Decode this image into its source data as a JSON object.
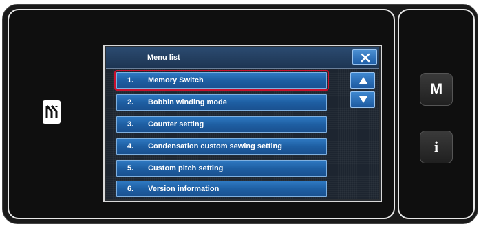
{
  "screen": {
    "title": "Menu list",
    "close_icon": "close-icon",
    "menu_items": [
      {
        "number": "1.",
        "label": "Memory Switch",
        "selected": true
      },
      {
        "number": "2.",
        "label": "Bobbin winding mode",
        "selected": false
      },
      {
        "number": "3.",
        "label": "Counter setting",
        "selected": false
      },
      {
        "number": "4.",
        "label": "Condensation custom sewing setting",
        "selected": false
      },
      {
        "number": "5.",
        "label": "Custom pitch setting",
        "selected": false
      },
      {
        "number": "6.",
        "label": "Version information",
        "selected": false
      }
    ],
    "scroll_up_icon": "triangle-up-icon",
    "scroll_down_icon": "triangle-down-icon"
  },
  "side_buttons": {
    "m_label": "M",
    "info_label": "i"
  },
  "colors": {
    "button_blue": "#1e5fa3",
    "selection_outline": "#c8102e",
    "panel_background": "#0f0f0f"
  },
  "left_icon": "nfc-icon"
}
